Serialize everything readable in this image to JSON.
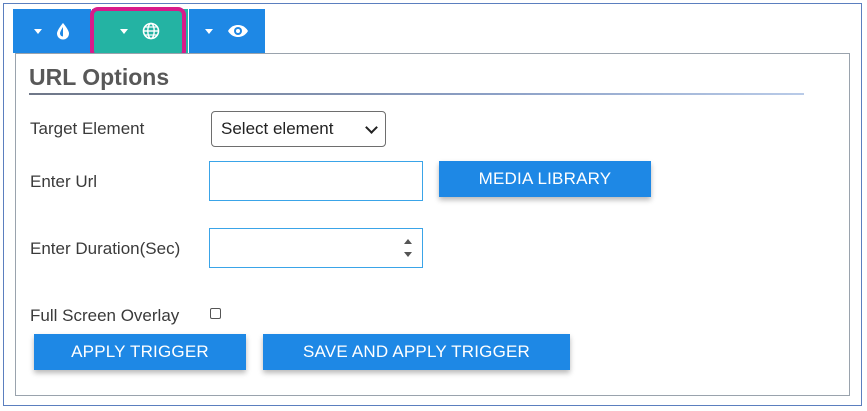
{
  "tabs": [
    {
      "name": "effects",
      "icon": "droplet-icon",
      "active": false
    },
    {
      "name": "url",
      "icon": "globe-icon",
      "active": true
    },
    {
      "name": "view",
      "icon": "eye-icon",
      "active": false
    }
  ],
  "panel": {
    "title": "URL Options",
    "target_element": {
      "label": "Target Element",
      "selected": "Select element"
    },
    "url": {
      "label": "Enter Url",
      "value": "",
      "media_button": "MEDIA LIBRARY"
    },
    "duration": {
      "label": "Enter Duration(Sec)",
      "value": ""
    },
    "overlay": {
      "label": "Full Screen Overlay",
      "checked": false
    },
    "actions": {
      "apply": "APPLY TRIGGER",
      "save_apply": "SAVE AND APPLY TRIGGER"
    }
  },
  "colors": {
    "primary": "#1e88e5",
    "active_tab": "#24b3a3",
    "highlight": "#d81b8a"
  }
}
